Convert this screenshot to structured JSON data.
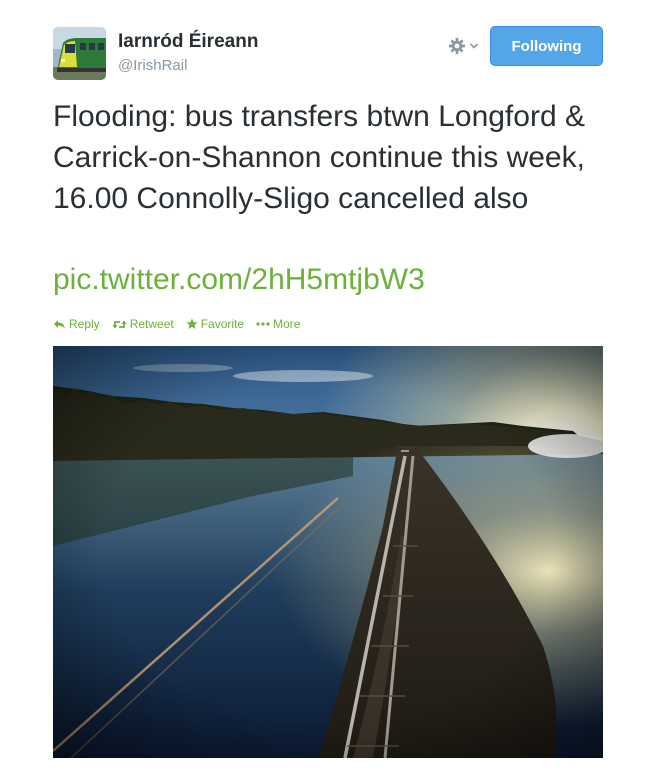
{
  "user": {
    "name": "Iarnród Éireann",
    "handle": "@IrishRail"
  },
  "follow_button": {
    "label": "Following"
  },
  "tweet": {
    "text": "Flooding: bus transfers btwn Longford & Carrick-on-Shannon continue this week, 16.00 Connolly-Sligo cancelled also",
    "link": "pic.twitter.com/2hH5mtjbW3"
  },
  "actions": {
    "reply": "Reply",
    "retweet": "Retweet",
    "favorite": "Favorite",
    "more": "More"
  },
  "icons": {
    "gear": "gear-icon",
    "reply": "reply-icon",
    "retweet": "retweet-icon",
    "favorite": "star-icon",
    "more": "ellipsis-icon"
  },
  "colors": {
    "link": "#6ab23a",
    "button": "#55a6e8",
    "text": "#292f33",
    "muted": "#8899a6"
  }
}
